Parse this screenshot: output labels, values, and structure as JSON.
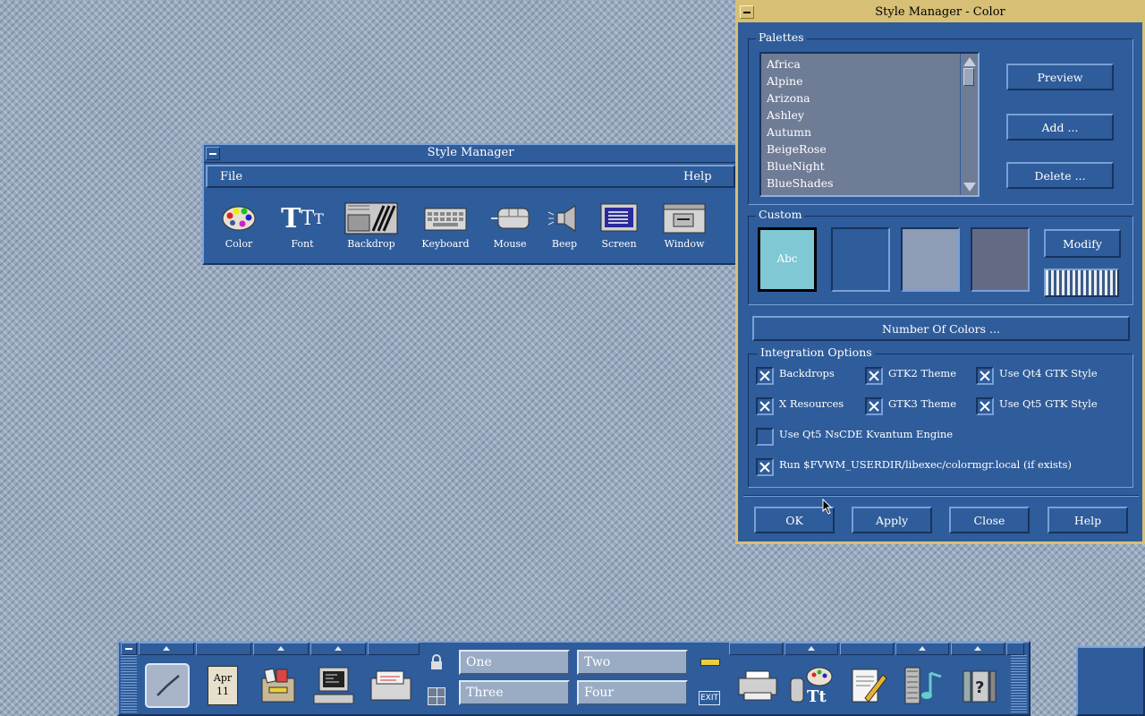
{
  "style_manager": {
    "title": "Style Manager",
    "menu": {
      "file": "File",
      "help": "Help"
    },
    "tools": [
      {
        "label": "Color",
        "icon": "palette-icon"
      },
      {
        "label": "Font",
        "icon": "font-icon"
      },
      {
        "label": "Backdrop",
        "icon": "backdrop-icon"
      },
      {
        "label": "Keyboard",
        "icon": "keyboard-icon"
      },
      {
        "label": "Mouse",
        "icon": "mouse-icon"
      },
      {
        "label": "Beep",
        "icon": "speaker-icon"
      },
      {
        "label": "Screen",
        "icon": "screen-icon"
      },
      {
        "label": "Window",
        "icon": "window-icon"
      }
    ]
  },
  "color_dialog": {
    "title": "Style Manager - Color",
    "palettes": {
      "title": "Palettes",
      "items": [
        "Africa",
        "Alpine",
        "Arizona",
        "Ashley",
        "Autumn",
        "BeigeRose",
        "BlueNight",
        "BlueShades"
      ],
      "preview": "Preview",
      "add": "Add ...",
      "delete": "Delete ..."
    },
    "custom": {
      "title": "Custom",
      "swatch_text": "Abc",
      "modify": "Modify",
      "swatch_colors": [
        "#7fc8d4",
        "#2f5c9a",
        "#8f9cb5",
        "#636b84"
      ]
    },
    "number_of_colors": "Number Of Colors ...",
    "integration": {
      "title": "Integration Options",
      "options": [
        {
          "label": "Backdrops",
          "checked": true
        },
        {
          "label": "GTK2 Theme",
          "checked": true
        },
        {
          "label": "Use Qt4 GTK Style",
          "checked": true
        },
        {
          "label": "X Resources",
          "checked": true
        },
        {
          "label": "GTK3 Theme",
          "checked": true
        },
        {
          "label": "Use Qt5 GTK Style",
          "checked": true
        },
        {
          "label": "Use Qt5 NsCDE Kvantum Engine",
          "checked": false
        },
        {
          "label": "Run $FVWM_USERDIR/libexec/colormgr.local (if exists)",
          "checked": true
        }
      ]
    },
    "buttons": {
      "ok": "OK",
      "apply": "Apply",
      "close": "Close",
      "help": "Help"
    }
  },
  "front_panel": {
    "calendar": {
      "month": "Apr",
      "day": "11"
    },
    "workspaces": [
      "One",
      "Two",
      "Three",
      "Four"
    ],
    "exit_label": "EXIT"
  },
  "colors": {
    "window_bg": "#2f5c9a",
    "active_title": "#d7bf76",
    "desktop": "#9aabc0"
  }
}
